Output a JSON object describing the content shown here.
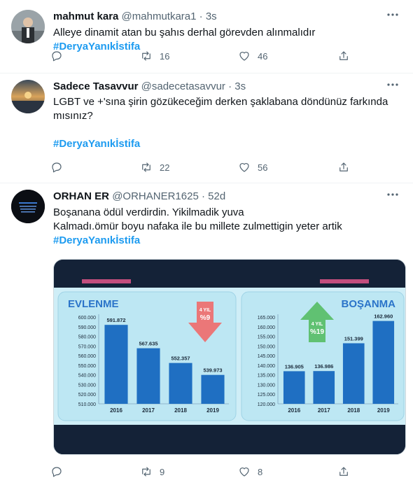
{
  "tweets": [
    {
      "name": "mahmut kara",
      "handle": "@mahmutkara1",
      "time": "3s",
      "lines": [
        "Alleye dinamit atan bu şahıs derhal görevden alınmalıdır "
      ],
      "hashtag": "#DeryaYanıkİstifa",
      "replies": "",
      "retweets": "16",
      "likes": "46"
    },
    {
      "name": "Sadece Tasavvur",
      "handle": "@sadecetasavvur",
      "time": "3s",
      "lines": [
        "LGBT ve +'sına şirin gözükeceğim derken şaklabana döndünüz farkında",
        "mısınız?"
      ],
      "hashtag": "#DeryaYanıkİstifa",
      "replies": "",
      "retweets": "22",
      "likes": "56"
    },
    {
      "name": "ORHAN ER",
      "handle": "@ORHANER1625",
      "time": "52d",
      "lines": [
        "Boşanana ödül verdirdin. Yikilmadik yuva",
        "Kalmadı.ömür boyu nafaka ile bu millete zulmettigin yeter artik"
      ],
      "hashtag": "#DeryaYanıkİstifa",
      "replies": "",
      "retweets": "9",
      "likes": "8"
    }
  ],
  "separator": "·",
  "icons": {
    "more": "more-icon",
    "reply": "reply-icon",
    "retweet": "retweet-icon",
    "like": "heart-icon",
    "share": "share-icon"
  },
  "colors": {
    "hashtag": "#1d9bf0",
    "secondary": "#536471",
    "chart_bar": "#1f6fc2",
    "chart_panel": "#bde7f3"
  },
  "chart_data": [
    {
      "type": "bar",
      "title": "EVLENME",
      "categories": [
        "2016",
        "2017",
        "2018",
        "2019"
      ],
      "values": [
        591872,
        567635,
        552357,
        539973
      ],
      "value_labels": [
        "591.872",
        "567.635",
        "552.357",
        "539.973"
      ],
      "ylim": [
        510000,
        600000
      ],
      "ticks": [
        "600.000",
        "590.000",
        "580.000",
        "570.000",
        "560.000",
        "550.000",
        "540.000",
        "530.000",
        "520.000",
        "510.000"
      ],
      "badge": [
        "4 YIL",
        "%9"
      ],
      "badge_direction": "down"
    },
    {
      "type": "bar",
      "title": "BOŞANMA",
      "categories": [
        "2016",
        "2017",
        "2018",
        "2019"
      ],
      "values": [
        136905,
        136986,
        151399,
        162960
      ],
      "value_labels": [
        "136.905",
        "136.986",
        "151.399",
        "162.960"
      ],
      "ylim": [
        120000,
        165000
      ],
      "ticks": [
        "165.000",
        "160.000",
        "155.000",
        "150.000",
        "145.000",
        "140.000",
        "135.000",
        "130.000",
        "125.000",
        "120.000"
      ],
      "badge": [
        "4 YIL",
        "%19"
      ],
      "badge_direction": "up"
    }
  ]
}
